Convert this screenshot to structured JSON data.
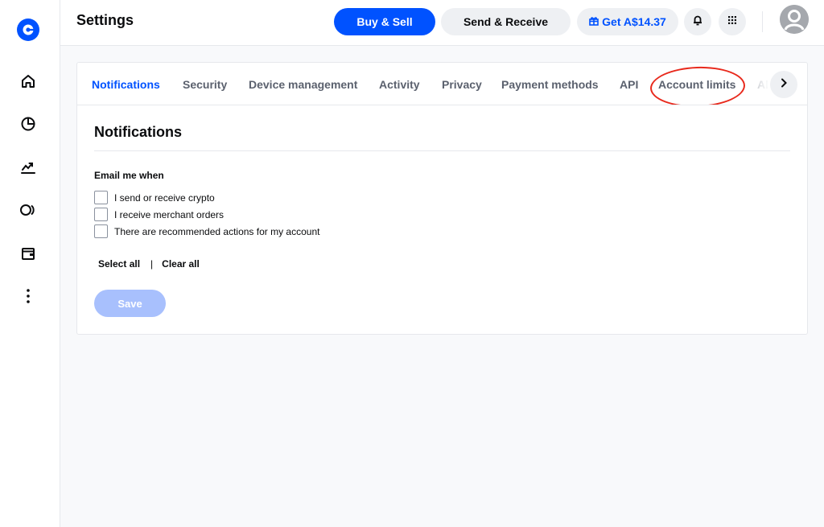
{
  "header": {
    "title": "Settings",
    "buy_sell_label": "Buy & Sell",
    "send_receive_label": "Send & Receive",
    "get_reward_label": "Get A$14.37"
  },
  "sidebar": {
    "items": [
      {
        "name": "home",
        "icon": "home-icon"
      },
      {
        "name": "portfolio",
        "icon": "pie-chart-icon"
      },
      {
        "name": "trade",
        "icon": "trending-up-icon"
      },
      {
        "name": "earn",
        "icon": "earn-icon"
      },
      {
        "name": "wallet",
        "icon": "wallet-icon"
      },
      {
        "name": "more",
        "icon": "more-vertical-icon"
      }
    ]
  },
  "tabs": [
    {
      "label": "Notifications",
      "active": true
    },
    {
      "label": "Security"
    },
    {
      "label": "Device management"
    },
    {
      "label": "Activity"
    },
    {
      "label": "Privacy"
    },
    {
      "label": "Payment methods"
    },
    {
      "label": "API"
    },
    {
      "label": "Account limits",
      "highlighted": true
    },
    {
      "label": "Al",
      "partial": true
    }
  ],
  "notifications": {
    "title": "Notifications",
    "group_label": "Email me when",
    "options": [
      {
        "label": "I send or receive crypto",
        "checked": false
      },
      {
        "label": "I receive merchant orders",
        "checked": false
      },
      {
        "label": "There are recommended actions for my account",
        "checked": false
      }
    ],
    "select_all_label": "Select all",
    "separator": "|",
    "clear_all_label": "Clear all",
    "save_label": "Save"
  },
  "colors": {
    "brand": "#0052ff",
    "save_disabled": "#a8c0fd",
    "highlight": "#e8291c"
  }
}
